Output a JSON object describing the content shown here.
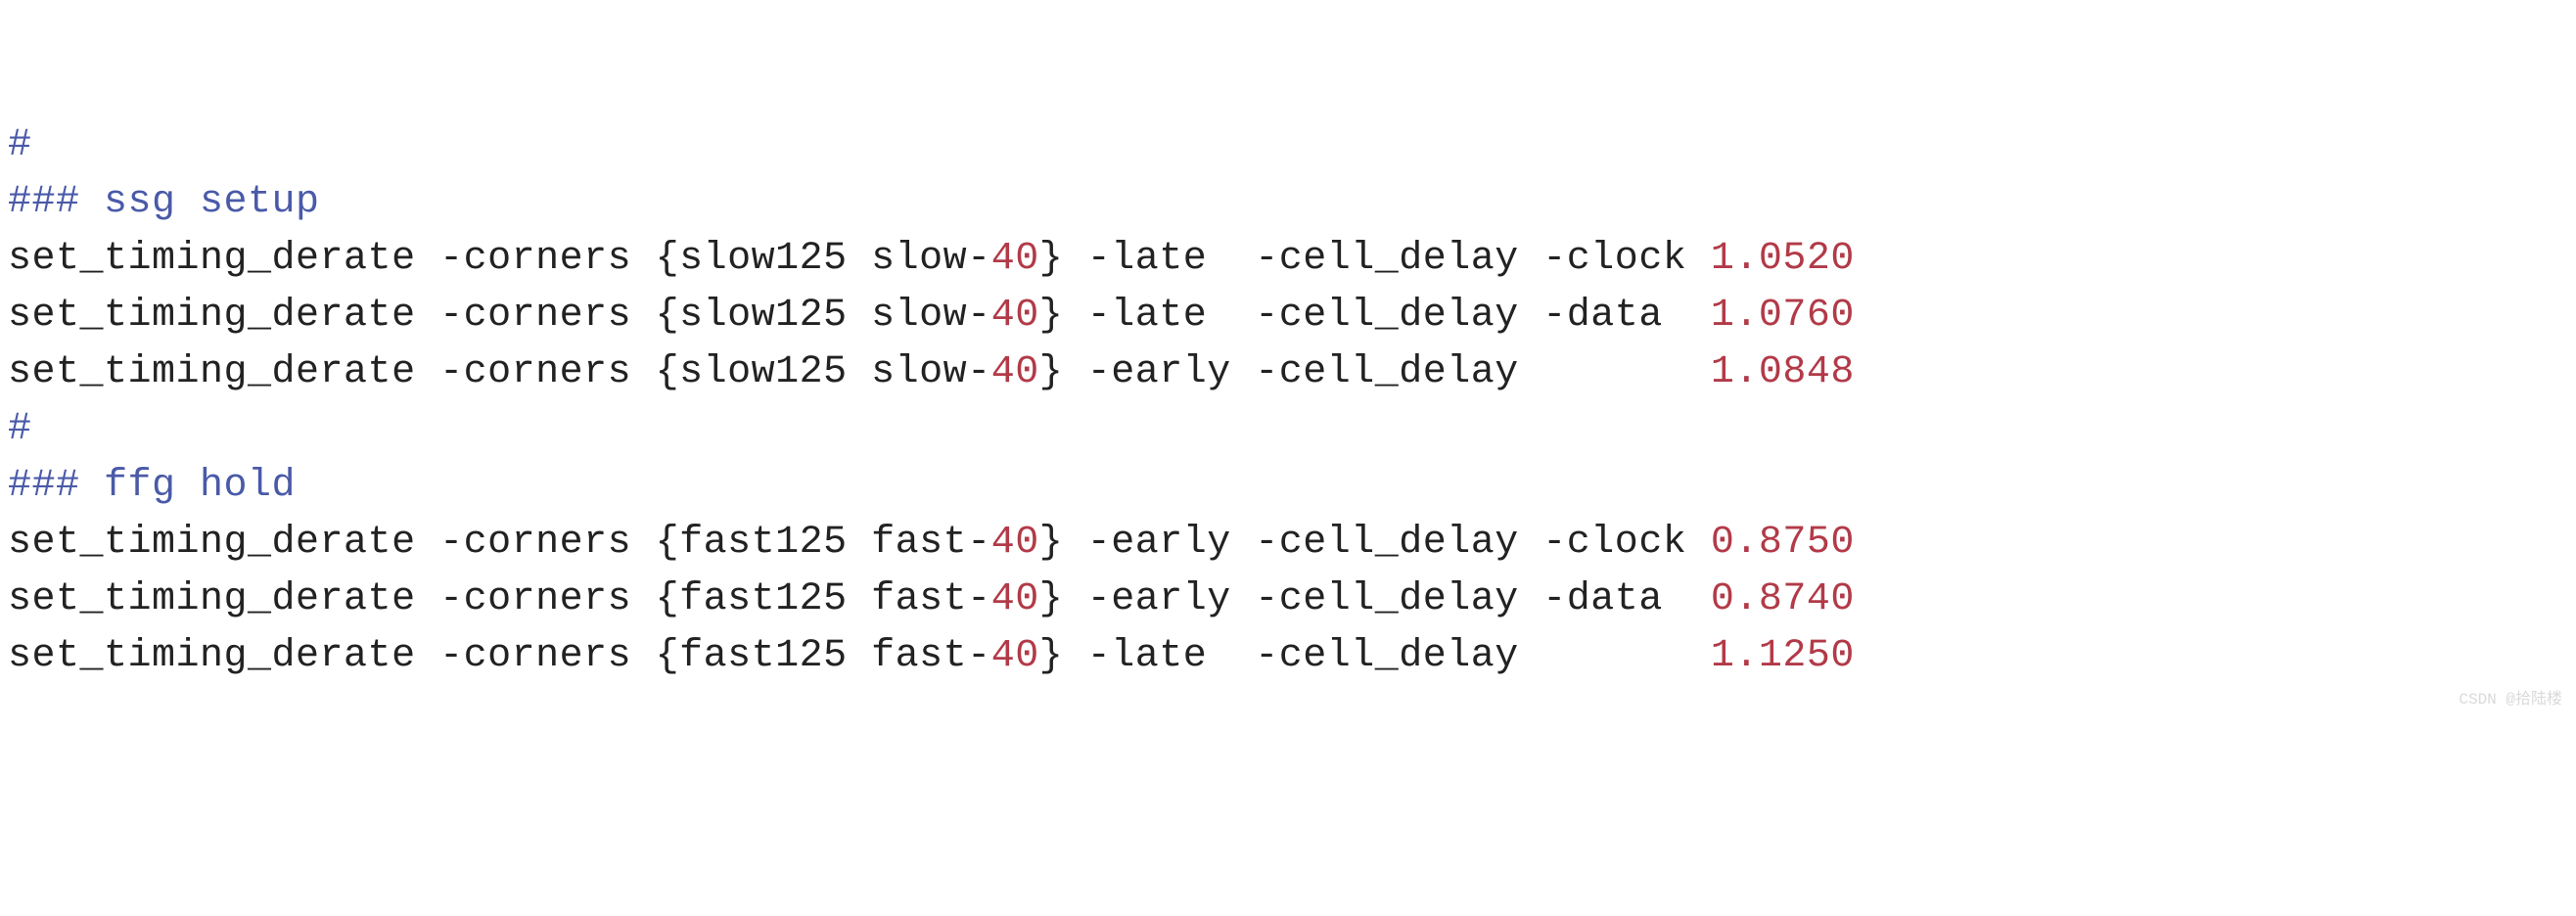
{
  "l0": "#",
  "h1": "### ssg setup",
  "s1": {
    "cmd": "set_timing_derate -corners ",
    "braceL": "{",
    "p1": "slow125 slow-",
    "p2": "40",
    "braceR": "}",
    "flags": " -late  -cell_delay -clock ",
    "val": "1.0520"
  },
  "s2": {
    "cmd": "set_timing_derate -corners ",
    "braceL": "{",
    "p1": "slow125 slow-",
    "p2": "40",
    "braceR": "}",
    "flags": " -late  -cell_delay -data  ",
    "val": "1.0760"
  },
  "s3": {
    "cmd": "set_timing_derate -corners ",
    "braceL": "{",
    "p1": "slow125 slow-",
    "p2": "40",
    "braceR": "}",
    "flags": " -early -cell_delay        ",
    "val": "1.0848"
  },
  "l4": "#",
  "h2": "### ffg hold",
  "f1": {
    "cmd": "set_timing_derate -corners ",
    "braceL": "{",
    "p1": "fast125 fast-",
    "p2": "40",
    "braceR": "}",
    "flags": " -early -cell_delay -clock ",
    "val": "0.8750"
  },
  "f2": {
    "cmd": "set_timing_derate -corners ",
    "braceL": "{",
    "p1": "fast125 fast-",
    "p2": "40",
    "braceR": "}",
    "flags": " -early -cell_delay -data  ",
    "val": "0.8740"
  },
  "f3": {
    "cmd": "set_timing_derate -corners ",
    "braceL": "{",
    "p1": "fast125 fast-",
    "p2": "40",
    "braceR": "}",
    "flags": " -late  -cell_delay        ",
    "val": "1.1250"
  },
  "wm": "CSDN @拾陆楼"
}
